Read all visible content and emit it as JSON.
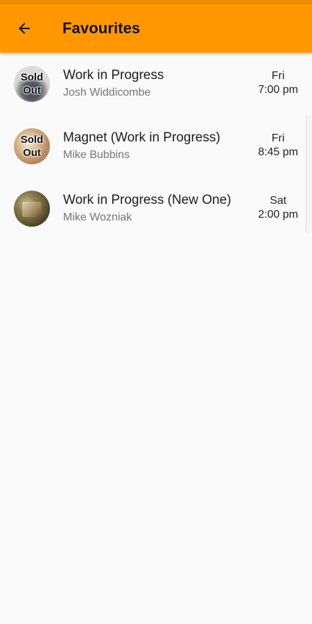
{
  "app_bar": {
    "title": "Favourites",
    "back_icon": "arrow-left-icon",
    "color": "#ff9800"
  },
  "favourites": [
    {
      "title": "Work in Progress",
      "performer": "Josh Widdicombe",
      "day": "Fri",
      "time": "7:00 pm",
      "sold_out_line1": "Sold",
      "sold_out_line2": "Out"
    },
    {
      "title": "Magnet (Work in Progress)",
      "performer": "Mike Bubbins",
      "day": "Fri",
      "time": "8:45 pm",
      "sold_out_line1": "Sold",
      "sold_out_line2": "Out"
    },
    {
      "title": "Work in Progress (New One)",
      "performer": "Mike Wozniak",
      "day": "Sat",
      "time": "2:00 pm"
    }
  ]
}
